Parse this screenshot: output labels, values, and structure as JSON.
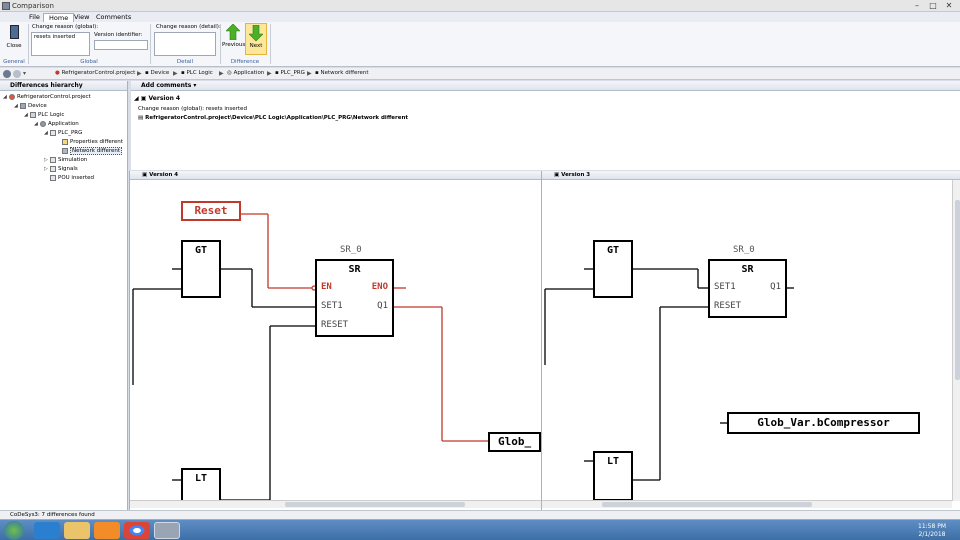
{
  "window": {
    "title": "Comparison",
    "minimize": "–",
    "maximize": "□",
    "close": "✕"
  },
  "menu": [
    "File",
    "Home",
    "View",
    "Comments"
  ],
  "ribbon": {
    "close_label": "Close",
    "general_label": "General",
    "change_reason_global_label": "Change reason (global):",
    "change_reason_global_value": "resets inserted",
    "version_identifier_label": "Version identifier:",
    "version_identifier_value": "",
    "global_label": "Global",
    "change_reason_detail_label": "Change reason (detail):",
    "change_reason_detail_value": "",
    "detail_label": "Detail",
    "previous_label": "Previous",
    "next_label": "Next",
    "difference_label": "Difference"
  },
  "breadcrumbs": [
    "RefrigeratorControl.project",
    "Device",
    "PLC Logic",
    "Application",
    "PLC_PRG",
    "Network different"
  ],
  "left_pane": {
    "title": "Differences hierarchy",
    "tree": [
      "RefrigeratorControl.project",
      "Device",
      "PLC Logic",
      "Application",
      "PLC_PRG",
      "Properties different",
      "Network different",
      "Simulation",
      "Signals",
      "POU inserted"
    ]
  },
  "top_pane": {
    "add_comments": "Add comments",
    "version": "Version 4",
    "change_reason": "Change reason (global):  resets inserted",
    "path": "RefrigeratorControl.project\\Device\\PLC Logic\\Application\\PLC_PRG\\Network different"
  },
  "left_diagram": {
    "title": "Version 4",
    "reset": "Reset",
    "gt": "GT",
    "lt": "LT",
    "sr_instance": "SR_0",
    "sr_type": "SR",
    "en": "EN",
    "eno": "ENO",
    "set1": "SET1",
    "q1": "Q1",
    "reset_pin": "RESET",
    "glob": "Glob_"
  },
  "right_diagram": {
    "title": "Version 3",
    "gt": "GT",
    "lt": "LT",
    "sr_instance": "SR_0",
    "sr_type": "SR",
    "set1": "SET1",
    "q1": "Q1",
    "reset_pin": "RESET",
    "glob": "Glob_Var.bCompressor"
  },
  "status": "CoDeSys3: 7 differences found",
  "taskbar": {
    "time": "11:58 PM",
    "date": "2/1/2018"
  },
  "colors": {
    "diff_red": "#c0392b",
    "ribbon_group": "#3b5f9a",
    "taskbar": "#3d6fa7"
  }
}
